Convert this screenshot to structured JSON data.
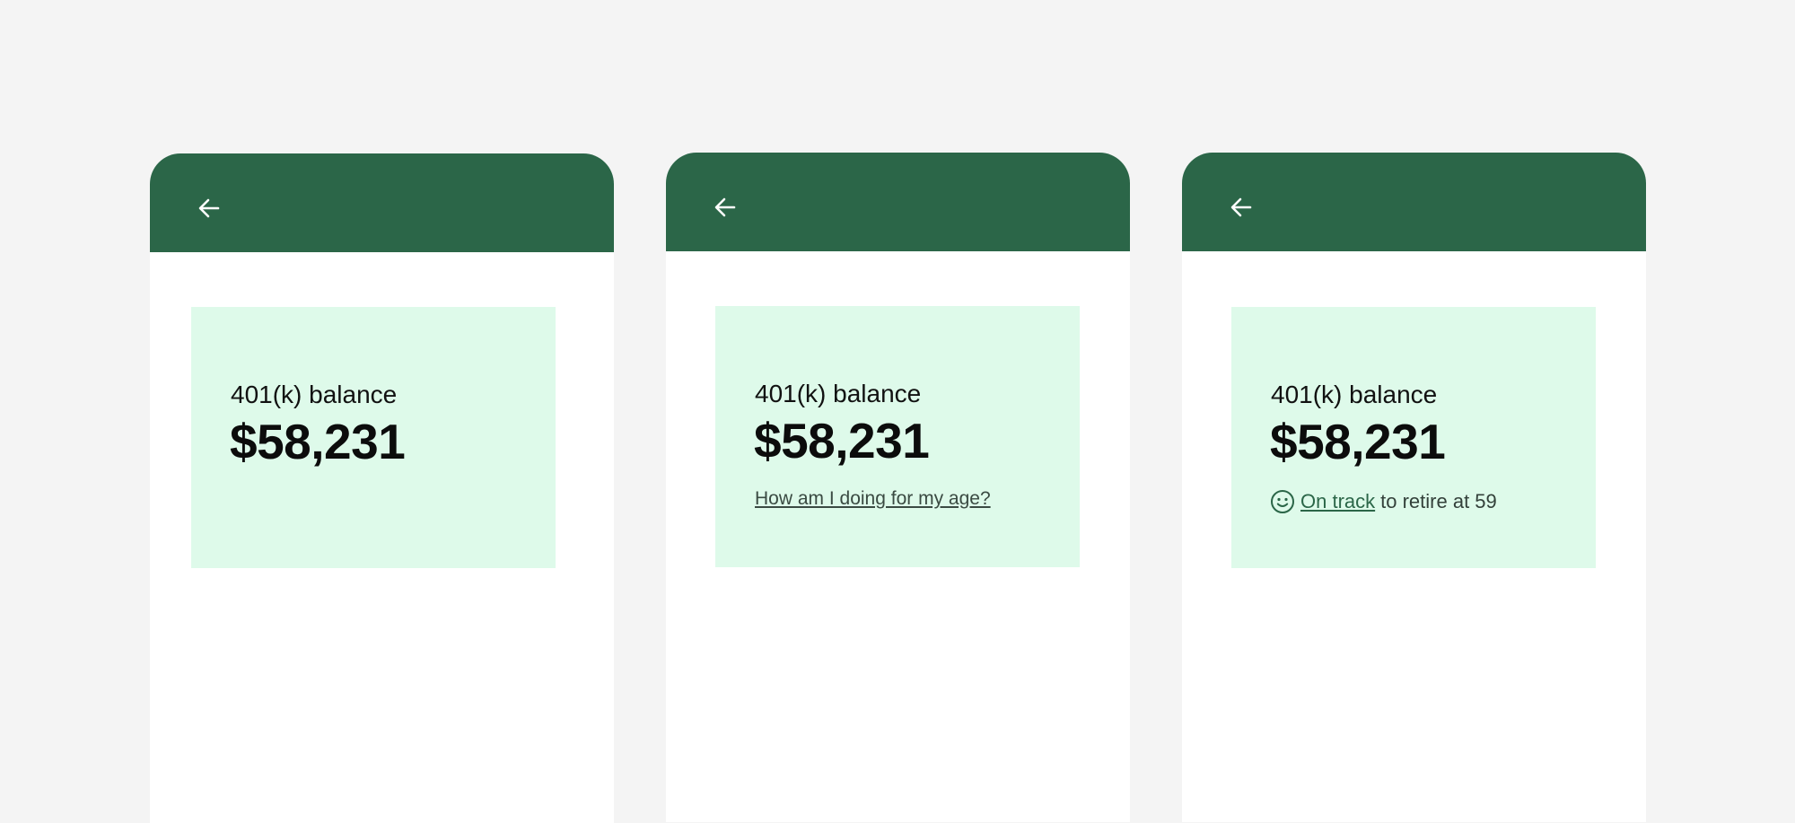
{
  "colors": {
    "background": "#f4f4f4",
    "appbar": "#2b6648",
    "card": "#defaea",
    "link": "#2b6648"
  },
  "icons": {
    "back": "arrow-left-icon",
    "status": "smiley-icon"
  },
  "screens": [
    {
      "card": {
        "label": "401(k) balance",
        "amount": "$58,231"
      }
    },
    {
      "card": {
        "label": "401(k) balance",
        "amount": "$58,231",
        "link_text": "How am I doing for my age?"
      }
    },
    {
      "card": {
        "label": "401(k) balance",
        "amount": "$58,231",
        "status_link": "On track",
        "status_text": "to retire at 59"
      }
    }
  ]
}
